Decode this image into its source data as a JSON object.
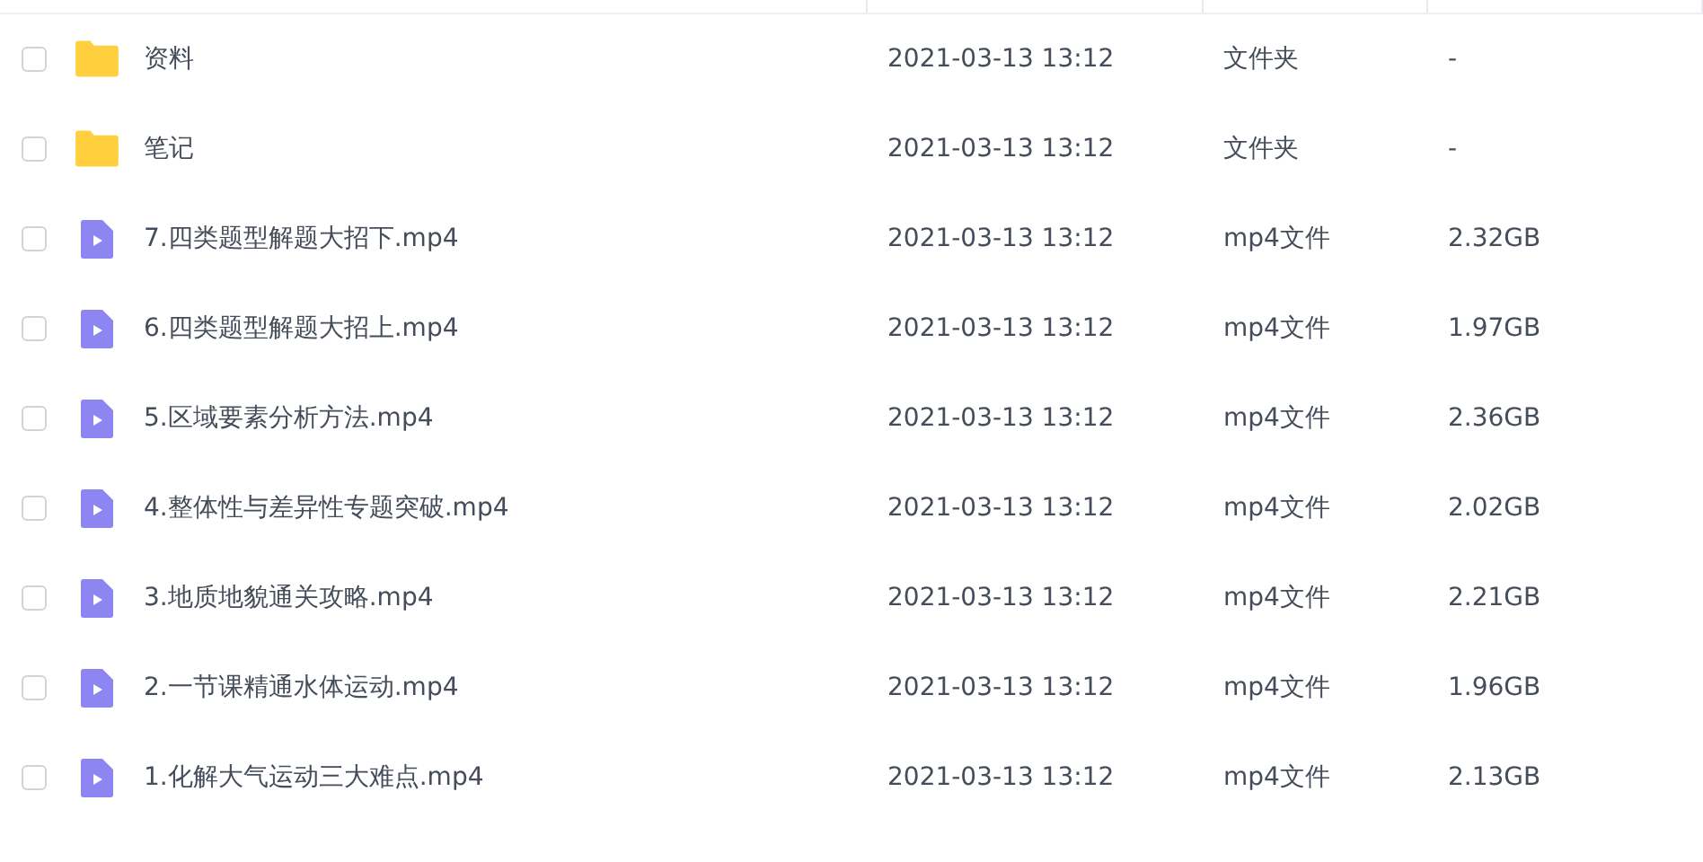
{
  "files": [
    {
      "kind": "folder",
      "name": "资料",
      "modified": "2021-03-13 13:12",
      "type": "文件夹",
      "size": "-",
      "checked": false
    },
    {
      "kind": "folder",
      "name": "笔记",
      "modified": "2021-03-13 13:12",
      "type": "文件夹",
      "size": "-",
      "checked": false
    },
    {
      "kind": "video",
      "name": "7.四类题型解题大招下.mp4",
      "modified": "2021-03-13 13:12",
      "type": "mp4文件",
      "size": "2.32GB",
      "checked": false
    },
    {
      "kind": "video",
      "name": "6.四类题型解题大招上.mp4",
      "modified": "2021-03-13 13:12",
      "type": "mp4文件",
      "size": "1.97GB",
      "checked": false
    },
    {
      "kind": "video",
      "name": "5.区域要素分析方法.mp4",
      "modified": "2021-03-13 13:12",
      "type": "mp4文件",
      "size": "2.36GB",
      "checked": false
    },
    {
      "kind": "video",
      "name": "4.整体性与差异性专题突破.mp4",
      "modified": "2021-03-13 13:12",
      "type": "mp4文件",
      "size": "2.02GB",
      "checked": false
    },
    {
      "kind": "video",
      "name": "3.地质地貌通关攻略.mp4",
      "modified": "2021-03-13 13:12",
      "type": "mp4文件",
      "size": "2.21GB",
      "checked": false
    },
    {
      "kind": "video",
      "name": "2.一节课精通水体运动.mp4",
      "modified": "2021-03-13 13:12",
      "type": "mp4文件",
      "size": "1.96GB",
      "checked": false
    },
    {
      "kind": "video",
      "name": "1.化解大气运动三大难点.mp4",
      "modified": "2021-03-13 13:12",
      "type": "mp4文件",
      "size": "2.13GB",
      "checked": false
    }
  ]
}
